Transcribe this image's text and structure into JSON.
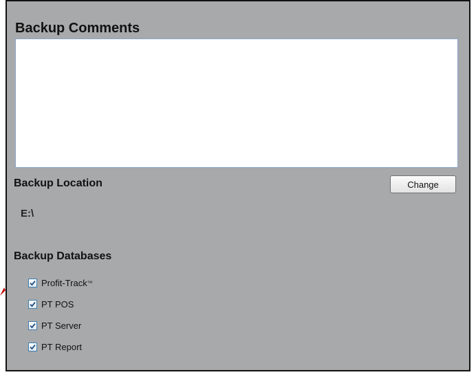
{
  "comments": {
    "title": "Backup Comments",
    "value": ""
  },
  "location": {
    "title": "Backup Location",
    "change_label": "Change",
    "path": "E:\\"
  },
  "databases": {
    "title": "Backup Databases",
    "items": [
      {
        "label": "Profit-Track",
        "suffix": "™",
        "checked": true
      },
      {
        "label": "PT POS",
        "suffix": "",
        "checked": true
      },
      {
        "label": "PT Server",
        "suffix": "",
        "checked": true
      },
      {
        "label": "PT Report",
        "suffix": "",
        "checked": true
      }
    ]
  },
  "colors": {
    "panel_bg": "#a8a9ab",
    "checkbox_border": "#3c7fb1",
    "check_mark": "#1f4f86",
    "pointer_arrow": "#c00000"
  }
}
